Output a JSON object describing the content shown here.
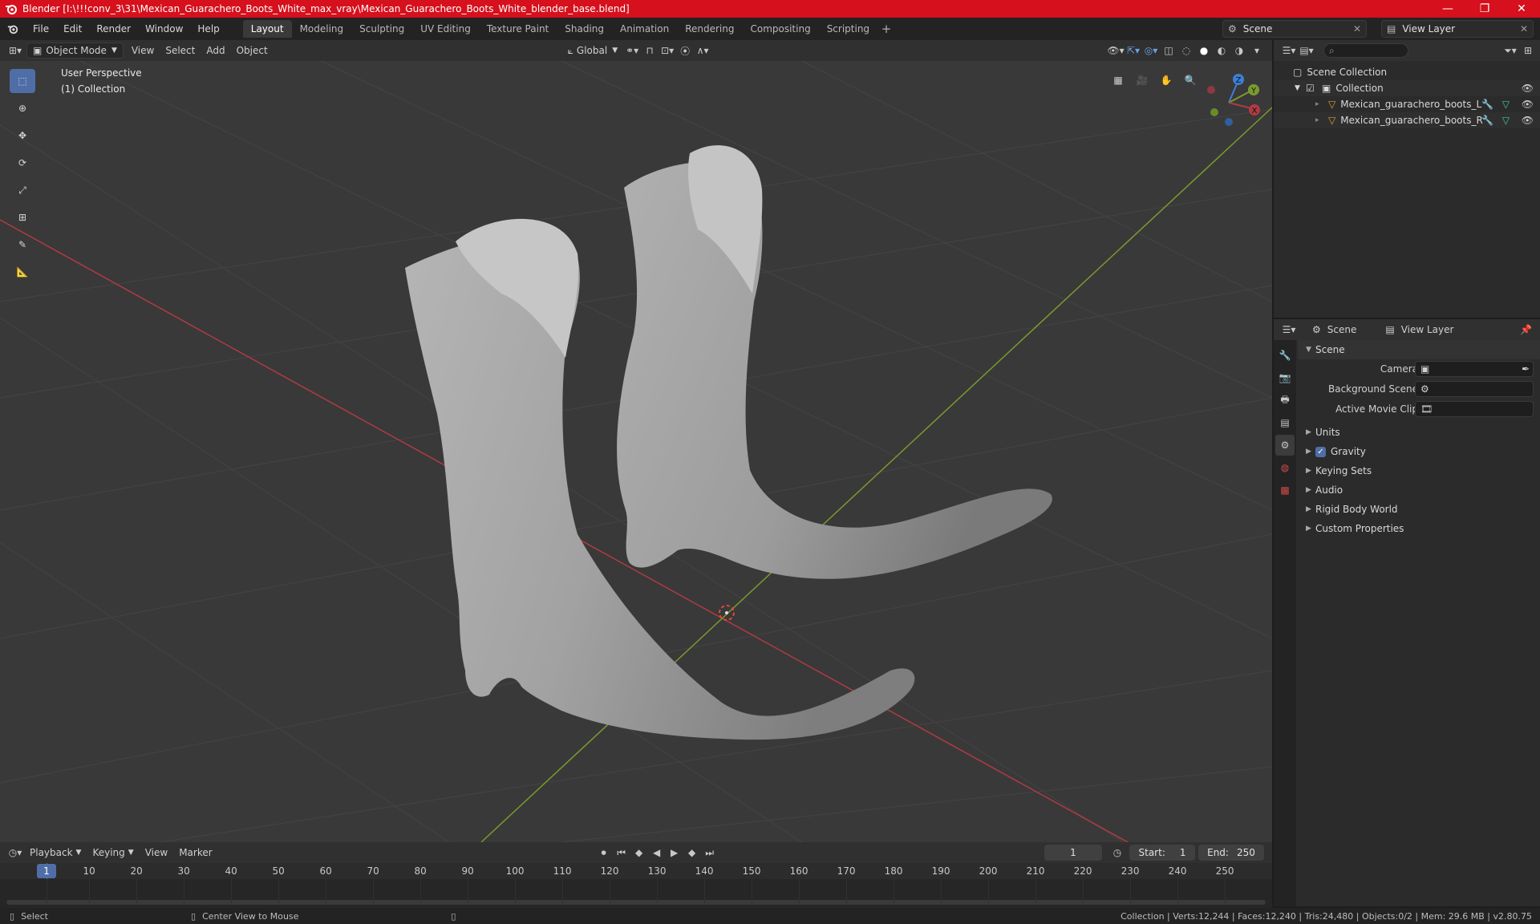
{
  "window": {
    "title": "Blender [I:\\!!!conv_3\\31\\Mexican_Guarachero_Boots_White_max_vray\\Mexican_Guarachero_Boots_White_blender_base.blend]",
    "minimize": "—",
    "maximize": "❐",
    "close": "✕"
  },
  "menu": [
    "File",
    "Edit",
    "Render",
    "Window",
    "Help"
  ],
  "workspaces": [
    "Layout",
    "Modeling",
    "Sculpting",
    "UV Editing",
    "Texture Paint",
    "Shading",
    "Animation",
    "Rendering",
    "Compositing",
    "Scripting"
  ],
  "active_workspace": "Layout",
  "scene_selector": {
    "value": "Scene"
  },
  "view_layer_selector": {
    "value": "View Layer"
  },
  "viewport_header": {
    "mode": "Object Mode",
    "menus": [
      "View",
      "Select",
      "Add",
      "Object"
    ],
    "transform_orientation": "Global"
  },
  "viewport": {
    "perspective_label": "User Perspective",
    "collection_label": "(1) Collection",
    "gizmo": {
      "x": "X",
      "y": "Y",
      "z": "Z"
    }
  },
  "outliner": {
    "root": "Scene Collection",
    "collection": "Collection",
    "objects": [
      "Mexican_guarachero_boots_L",
      "Mexican_guarachero_boots_R"
    ]
  },
  "properties": {
    "header_scene": "Scene",
    "header_view_layer": "View Layer",
    "section_scene": "Scene",
    "fields": [
      {
        "label": "Camera"
      },
      {
        "label": "Background Scene"
      },
      {
        "label": "Active Movie Clip"
      }
    ],
    "sections": [
      "Units",
      "Gravity",
      "Keying Sets",
      "Audio",
      "Rigid Body World",
      "Custom Properties"
    ],
    "gravity_checked": true
  },
  "timeline": {
    "menus": [
      "Playback",
      "Keying",
      "View",
      "Marker"
    ],
    "current_frame": "1",
    "start_label": "Start:",
    "start": "1",
    "end_label": "End:",
    "end": "250",
    "ticks": [
      "1",
      "10",
      "20",
      "30",
      "40",
      "50",
      "60",
      "70",
      "80",
      "90",
      "100",
      "110",
      "120",
      "130",
      "140",
      "150",
      "160",
      "170",
      "180",
      "190",
      "200",
      "210",
      "220",
      "230",
      "240",
      "250"
    ]
  },
  "statusbar": {
    "select": "Select",
    "center_view": "Center View to Mouse",
    "stats": "Collection | Verts:12,244 | Faces:12,240 | Tris:24,480 | Objects:0/2 | Mem: 29.6 MB | v2.80.75"
  },
  "colors": {
    "title_bar": "#d6101c",
    "accent": "#4f6ea8",
    "x_axis": "#b03a44",
    "y_axis": "#7a9a2e",
    "z_axis": "#3d7fd6"
  }
}
